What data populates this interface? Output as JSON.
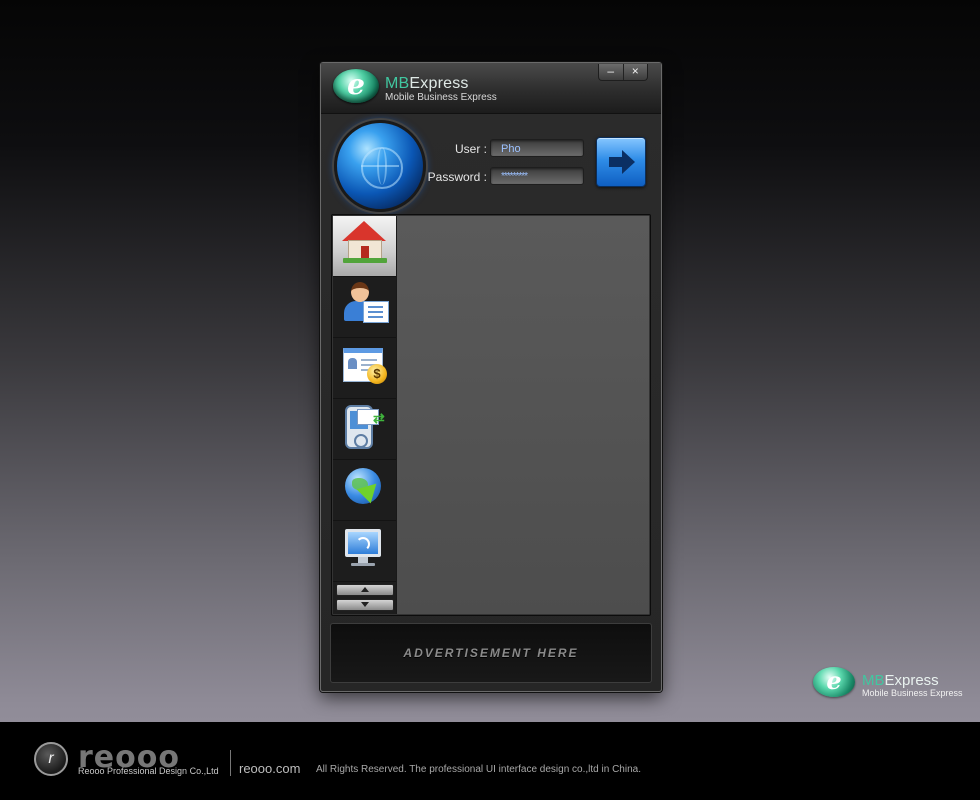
{
  "app": {
    "brand_prefix": "MB",
    "brand_suffix": "Express",
    "subtitle": "Mobile Business Express",
    "logo_letter": "e"
  },
  "window_controls": {
    "minimize": "–",
    "close": "×"
  },
  "login": {
    "user_label": "User :",
    "user_value": "Pho",
    "password_label": "Password :",
    "password_value": "*********"
  },
  "nav": {
    "items": [
      {
        "icon": "home-icon",
        "active": true
      },
      {
        "icon": "contacts-icon",
        "active": false
      },
      {
        "icon": "billing-card-icon",
        "active": false
      },
      {
        "icon": "mobile-mail-sync-icon",
        "active": false
      },
      {
        "icon": "globe-export-icon",
        "active": false
      },
      {
        "icon": "monitor-broadcast-icon",
        "active": false
      }
    ]
  },
  "ad": {
    "text": "ADVERTISEMENT HERE"
  },
  "watermark": {
    "brand_prefix": "MB",
    "brand_suffix": "Express",
    "subtitle": "Mobile Business Express",
    "logo_letter": "e"
  },
  "footer": {
    "company_logo_text": "reooo",
    "company_name": "Reooo Professional Design Co.,Ltd",
    "site": "reooo.com",
    "copyright": "All Rights Reserved. The professional UI interface design co.,ltd in China."
  },
  "colors": {
    "accent_green": "#41c7a0",
    "login_blue": "#2f8de8",
    "field_text": "#9cc1ff"
  }
}
